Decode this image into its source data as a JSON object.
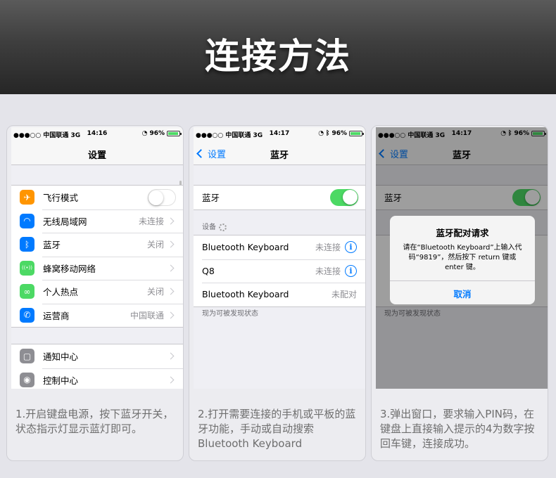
{
  "page_title": "连接方法",
  "status_bar": {
    "carrier": "●●●○○ 中国联通  3G",
    "battery": "96%",
    "times": [
      "14:16",
      "14:17",
      "14:17"
    ]
  },
  "card1": {
    "nav_title": "设置",
    "rows1": [
      {
        "icon": "airplane-icon",
        "glyph": "✈",
        "color": "#ff9500",
        "label": "飞行模式",
        "value": ""
      },
      {
        "icon": "wifi-icon",
        "glyph": "◠",
        "color": "#007aff",
        "label": "无线局域网",
        "value": "未连接"
      },
      {
        "icon": "bluetooth-icon",
        "glyph": "ᛒ",
        "color": "#007aff",
        "label": "蓝牙",
        "value": "关闭"
      },
      {
        "icon": "cellular-icon",
        "glyph": "((•))",
        "color": "#4cd964",
        "label": "蜂窝移动网络",
        "value": ""
      },
      {
        "icon": "hotspot-icon",
        "glyph": "∞",
        "color": "#4cd964",
        "label": "个人热点",
        "value": "关闭"
      },
      {
        "icon": "phone-icon",
        "glyph": "✆",
        "color": "#007aff",
        "label": "运营商",
        "value": "中国联通"
      }
    ],
    "rows2": [
      {
        "icon": "notification-icon",
        "glyph": "▢",
        "color": "#8e8e93",
        "label": "通知中心"
      },
      {
        "icon": "control-center-icon",
        "glyph": "◉",
        "color": "#8e8e93",
        "label": "控制中心"
      }
    ],
    "description": "1.开启键盘电源，按下蓝牙开关，状态指示灯显示蓝灯即可。"
  },
  "card2": {
    "back_label": "设置",
    "nav_title": "蓝牙",
    "toggle_label": "蓝牙",
    "section_label": "设备",
    "devices": [
      {
        "name": "Bluetooth Keyboard",
        "status": "未连接",
        "info": true
      },
      {
        "name": "Q8",
        "status": "未连接",
        "info": true
      },
      {
        "name": "Bluetooth Keyboard",
        "status": "未配对",
        "info": false
      }
    ],
    "footer_note": "现为可被发现状态",
    "description": "2.打开需要连接的手机或平板的蓝牙功能，手动或自动搜索Bluetooth Keyboard"
  },
  "card3": {
    "back_label": "设置",
    "nav_title": "蓝牙",
    "toggle_label": "蓝牙",
    "alert_title": "蓝牙配对请求",
    "alert_message": "请在“Bluetooth Keyboard”上输入代码“9819”，然后按下 return 键或 enter 键。",
    "alert_button": "取消",
    "footer_note": "现为可被发现状态",
    "description": "3.弹出窗口，要求输入PIN码，在键盘上直接输入提示的4为数字按回车键，连接成功。"
  }
}
